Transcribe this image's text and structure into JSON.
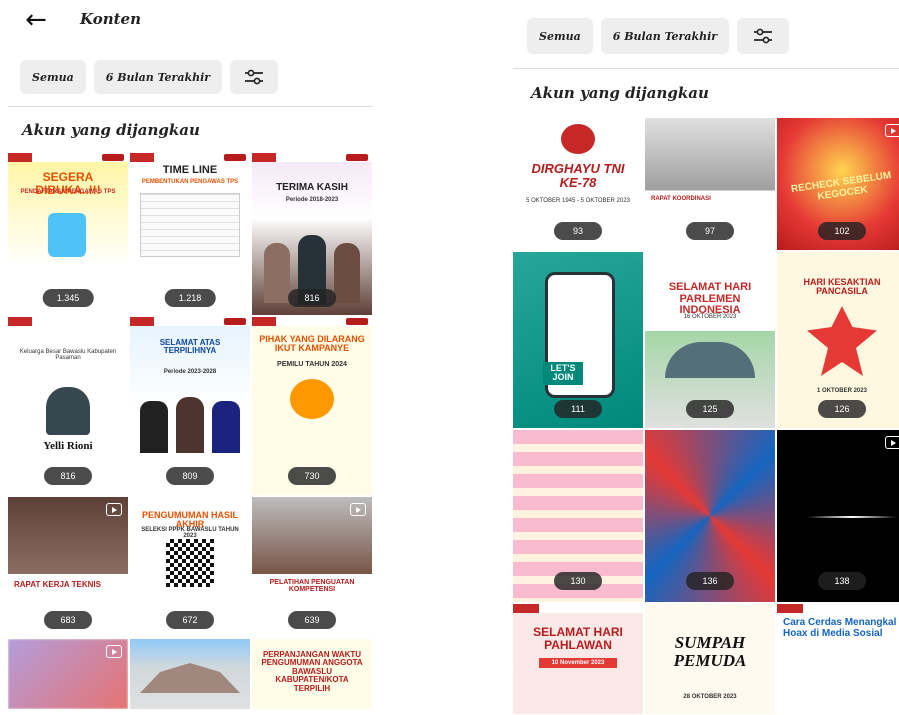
{
  "left": {
    "header": {
      "back_icon": "arrow-left-icon",
      "title": "Konten"
    },
    "filters": {
      "all": "Semua",
      "period": "6 Bulan Terakhir",
      "settings_icon": "sliders-icon"
    },
    "section_title": "Akun yang dijangkau",
    "tiles": [
      {
        "caption": "SEGERA DIBUKA..!!!",
        "sub": "PENDAFTARAN PENGAWAS TPS",
        "count": "1.345",
        "theme": "yellow"
      },
      {
        "caption": "TIME LINE",
        "sub": "PEMBENTUKAN PENGAWAS TPS",
        "count": "1.218",
        "theme": "table"
      },
      {
        "caption": "TERIMA KASIH",
        "sub": "Periode 2018-2023",
        "count": "816",
        "theme": "group"
      },
      {
        "caption": "Yelli Rioni",
        "sub": "Keluarga Besar Bawaslu Kabupaten Pasaman",
        "count": "816",
        "theme": "condolence"
      },
      {
        "caption": "SELAMAT ATAS TERPILIHNYA",
        "sub": "Periode 2023-2028",
        "count": "809",
        "theme": "blue"
      },
      {
        "caption": "PIHAK YANG DILARANG IKUT KAMPANYE",
        "sub": "PEMILU TAHUN 2024",
        "count": "730",
        "theme": "orange"
      },
      {
        "caption": "RAPAT KERJA TEKNIS",
        "sub": "",
        "count": "683",
        "theme": "meeting",
        "reel": true
      },
      {
        "caption": "PENGUMUMAN HASIL AKHIR",
        "sub": "SELEKSI PPPK BAWASLU TAHUN 2023",
        "count": "672",
        "theme": "qr"
      },
      {
        "caption": "PELATIHAN PENGUATAN KOMPETENSI",
        "sub": "",
        "count": "639",
        "theme": "crowd",
        "reel": true
      },
      {
        "caption": "",
        "sub": "",
        "count": "",
        "theme": "blur",
        "reel": true
      },
      {
        "caption": "",
        "sub": "",
        "count": "",
        "theme": "building"
      },
      {
        "caption": "PERPANJANGAN WAKTU PENGUMUMAN ANGGOTA BAWASLU KABUPATEN/KOTA TERPILIH",
        "sub": "",
        "count": "",
        "theme": "announce"
      }
    ]
  },
  "right": {
    "filters": {
      "all": "Semua",
      "period": "6 Bulan Terakhir",
      "settings_icon": "sliders-icon"
    },
    "section_title": "Akun yang dijangkau",
    "tiles": [
      {
        "caption": "DIRGHAYU TNI KE-78",
        "sub": "5 OKTOBER 1945 - 5 OKTOBER 2023",
        "count": "93",
        "theme": "tni"
      },
      {
        "caption": "RAPAT KOORDINASI",
        "sub": "",
        "count": "97",
        "theme": "office"
      },
      {
        "caption": "RECHECK SEBELUM KEGOCEK",
        "sub": "",
        "count": "102",
        "theme": "recheck",
        "reel": true
      },
      {
        "caption": "LET'S JOIN",
        "sub": "",
        "count": "111",
        "theme": "green"
      },
      {
        "caption": "SELAMAT HARI PARLEMEN INDONESIA",
        "sub": "16 OKTOBER 2023",
        "count": "125",
        "theme": "parliament"
      },
      {
        "caption": "HARI KESAKTIAN PANCASILA",
        "sub": "1 OKTOBER 2023",
        "count": "126",
        "theme": "pancasila"
      },
      {
        "caption": "",
        "sub": "",
        "count": "130",
        "theme": "chat"
      },
      {
        "caption": "",
        "sub": "",
        "count": "136",
        "theme": "abstract"
      },
      {
        "caption": "",
        "sub": "",
        "count": "138",
        "theme": "dark",
        "reel": true
      },
      {
        "caption": "SELAMAT HARI PAHLAWAN",
        "sub": "10 November 2023",
        "count": "",
        "theme": "pahlawan"
      },
      {
        "caption": "SUMPAH PEMUDA",
        "sub": "28 OKTOBER 2023",
        "count": "",
        "theme": "sumpah"
      },
      {
        "caption": "Cara Cerdas Menangkal Hoax di Media Sosial",
        "sub": "",
        "count": "",
        "theme": "hoax"
      }
    ]
  }
}
